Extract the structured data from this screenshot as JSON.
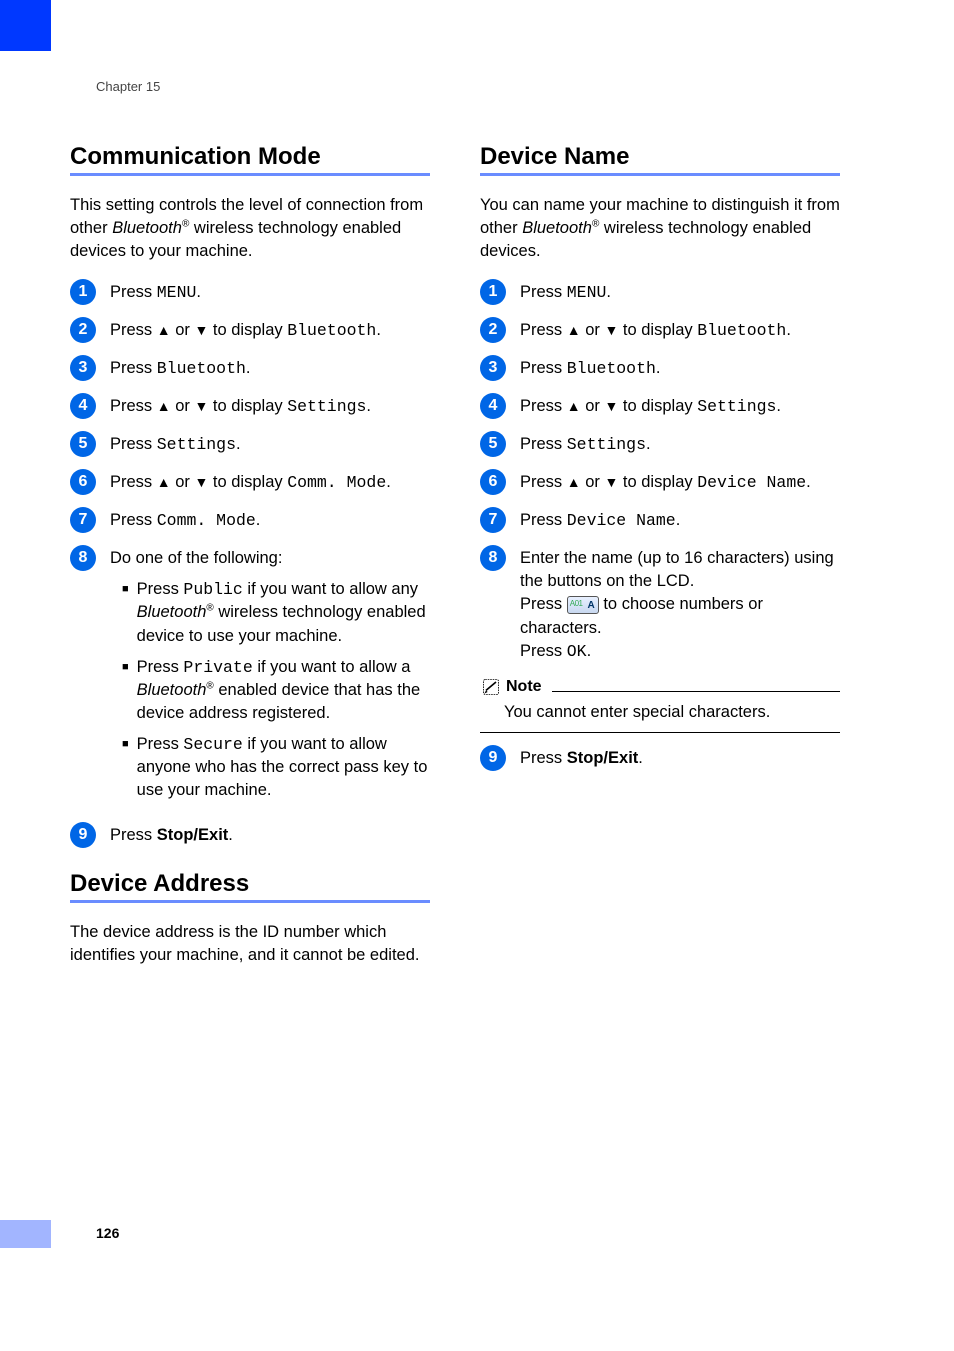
{
  "chapter": "Chapter 15",
  "page_number": "126",
  "left": {
    "section1": {
      "title": "Communication Mode",
      "intro_a": "This setting controls the level of connection from other ",
      "intro_b": "Bluetooth",
      "intro_c": " wireless technology enabled devices to your machine.",
      "steps": {
        "s1a": "Press ",
        "s1b": "MENU",
        "s1c": ".",
        "s2a": "Press ",
        "s2b": " or ",
        "s2c": " to display ",
        "s2d": "Bluetooth",
        "s2e": ".",
        "s3a": "Press ",
        "s3b": "Bluetooth",
        "s3c": ".",
        "s4a": "Press ",
        "s4b": " or ",
        "s4c": " to display ",
        "s4d": "Settings",
        "s4e": ".",
        "s5a": "Press ",
        "s5b": "Settings",
        "s5c": ".",
        "s6a": "Press ",
        "s6b": " or ",
        "s6c": " to display ",
        "s6d": "Comm. Mode",
        "s6e": ".",
        "s7a": "Press ",
        "s7b": "Comm. Mode",
        "s7c": ".",
        "s8": "Do one of the following:",
        "s8_1a": "Press ",
        "s8_1b": "Public",
        "s8_1c": " if you want to allow any ",
        "s8_1d": "Bluetooth",
        "s8_1e": " wireless technology enabled device to use your machine.",
        "s8_2a": "Press ",
        "s8_2b": "Private",
        "s8_2c": " if you want to allow a ",
        "s8_2d": "Bluetooth",
        "s8_2e": " enabled device that has the device address registered.",
        "s8_3a": "Press ",
        "s8_3b": "Secure",
        "s8_3c": " if you want to allow anyone who has the correct pass key to use your machine.",
        "s9a": "Press ",
        "s9b": "Stop/Exit",
        "s9c": "."
      }
    },
    "section2": {
      "title": "Device Address",
      "intro": "The device address is the ID number which identifies your machine, and it cannot be edited."
    }
  },
  "right": {
    "section1": {
      "title": "Device Name",
      "intro_a": "You can name your machine to distinguish it from other ",
      "intro_b": "Bluetooth",
      "intro_c": " wireless technology enabled devices.",
      "steps": {
        "s1a": "Press ",
        "s1b": "MENU",
        "s1c": ".",
        "s2a": "Press ",
        "s2b": " or ",
        "s2c": " to display ",
        "s2d": "Bluetooth",
        "s2e": ".",
        "s3a": "Press ",
        "s3b": "Bluetooth",
        "s3c": ".",
        "s4a": "Press ",
        "s4b": " or ",
        "s4c": " to display ",
        "s4d": "Settings",
        "s4e": ".",
        "s5a": "Press  ",
        "s5b": "Settings",
        "s5c": ".",
        "s6a": "Press ",
        "s6b": " or ",
        "s6c": " to display ",
        "s6d": "Device Name",
        "s6e": ".",
        "s7a": "Press ",
        "s7b": "Device Name",
        "s7c": ".",
        "s8a": "Enter the name (up to 16 characters) using the buttons on the LCD.",
        "s8b": "Press ",
        "s8c": " to choose numbers or characters.",
        "s8d": "Press ",
        "s8e": "OK",
        "s8f": ".",
        "s9a": "Press ",
        "s9b": "Stop/Exit",
        "s9c": "."
      },
      "note_title": "Note",
      "note_body": "You cannot enter special characters."
    }
  },
  "glyphs": {
    "up": "▲",
    "down": "▼",
    "reg": "®"
  }
}
